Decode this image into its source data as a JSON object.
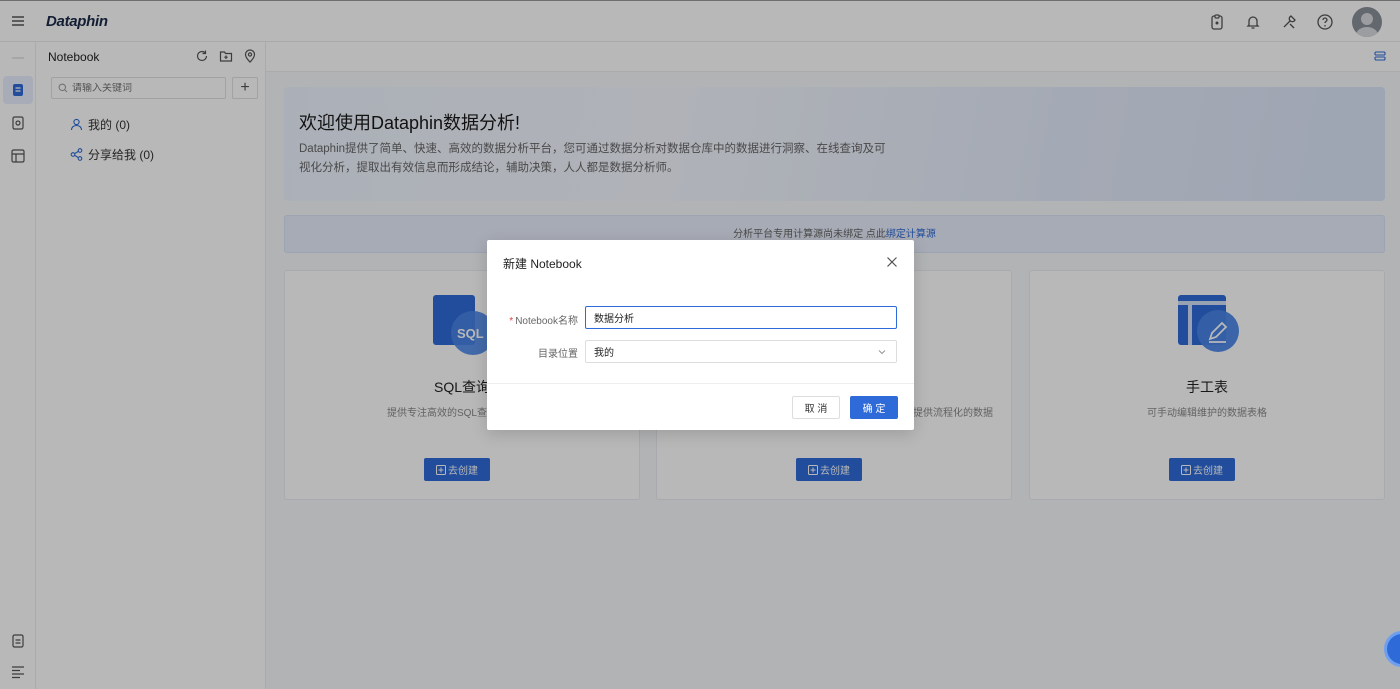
{
  "app": {
    "logo": "Dataphin"
  },
  "panel": {
    "title": "Notebook",
    "search_placeholder": "请输入关键词",
    "tree": [
      {
        "label": "我的 (0)"
      },
      {
        "label": "分享给我 (0)"
      }
    ]
  },
  "banner": {
    "title": "欢迎使用Dataphin数据分析!",
    "desc_line1": "Dataphin提供了简单、快速、高效的数据分析平台，您可通过数据分析对数据仓库中的数据进行洞察、在线查询及可",
    "desc_line2": "视化分析，提取出有效信息而形成结论，辅助决策，人人都是数据分析师。"
  },
  "notice": {
    "text": "分析平台专用计算源尚未绑定 点此",
    "link": "绑定计算源"
  },
  "cards": [
    {
      "title": "SQL查询",
      "desc": "提供专注高效的SQL查询能力与丰",
      "button": "去创建",
      "icon": "sql-icon"
    },
    {
      "title": "",
      "desc": "提供流程化的数据",
      "button": "去创建",
      "icon": "notebook-icon"
    },
    {
      "title": "手工表",
      "desc": "可手动编辑维护的数据表格",
      "button": "去创建",
      "icon": "edit-table-icon"
    }
  ],
  "modal": {
    "title": "新建 Notebook",
    "name_label": "Notebook名称",
    "name_value": "数据分析",
    "location_label": "目录位置",
    "location_value": "我的",
    "cancel": "取 消",
    "ok": "确 定"
  },
  "colors": {
    "primary": "#2f6bd8",
    "required": "#e84040"
  }
}
